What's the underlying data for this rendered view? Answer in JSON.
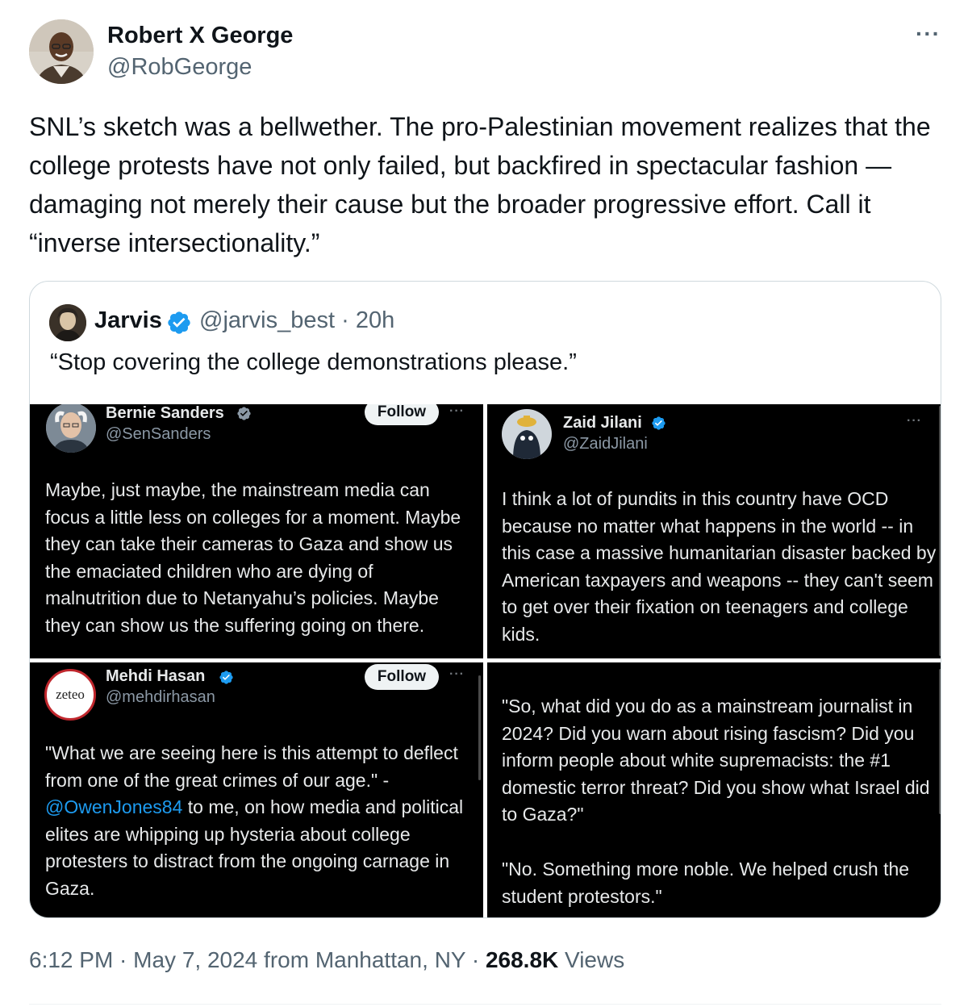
{
  "author": {
    "name": "Robert X George",
    "handle": "@RobGeorge",
    "more_label": "···"
  },
  "tweet": {
    "text": "SNL’s sketch was a bellwether. The pro-Palestinian movement realizes that the college protests have not only failed, but backfired in spectacular fashion — damaging not merely their cause but the broader progressive effort. Call it “inverse intersectionality.”"
  },
  "quote": {
    "name": "Jarvis",
    "handle_time": "@jarvis_best · 20h",
    "text": "“Stop covering the college demonstrations please.”",
    "verified_color": "#1d9bf0"
  },
  "posts": {
    "bernie": {
      "name": "Bernie Sanders",
      "handle": "@SenSanders",
      "follow": "Follow",
      "dots": "···",
      "body": "Maybe, just maybe, the mainstream media can focus a little less on colleges for a moment. Maybe they can take their cameras to Gaza and show us the emaciated children who are dying of malnutrition due to Netanyahu’s policies. Maybe they can show us the suffering going on there."
    },
    "zaid": {
      "name": "Zaid Jilani",
      "handle": "@ZaidJilani",
      "dots": "···",
      "body": "I think a lot of pundits in this country have OCD because no matter what happens in the world -- in this case a massive humanitarian disaster backed by American taxpayers and weapons -- they can't seem to get over their fixation on teenagers and college kids."
    },
    "mehdi": {
      "name": "Mehdi Hasan",
      "handle": "@mehdirhasan",
      "avatar_text": "zeteo",
      "follow": "Follow",
      "dots": "···",
      "body_start": "\"What we are seeing here is this attempt to deflect from one of the great crimes of our age.\" - ",
      "mention": "@OwenJones84",
      "body_end": " to me, on how media and political elites are whipping up hysteria about college protesters to distract from the ongoing carnage in Gaza."
    },
    "anon": {
      "para1": "\"So, what did you do as a mainstream journalist in 2024? Did you warn about rising fascism? Did you inform people about white supremacists: the #1 domestic terror threat? Did you show what Israel did to Gaza?\"",
      "para2": "\"No. Something more noble. We helped crush the student protestors.\""
    }
  },
  "footer": {
    "time_date_place": "6:12 PM · May 7, 2024 from Manhattan, NY · ",
    "views_count": "268.8K",
    "views_label": " Views"
  }
}
